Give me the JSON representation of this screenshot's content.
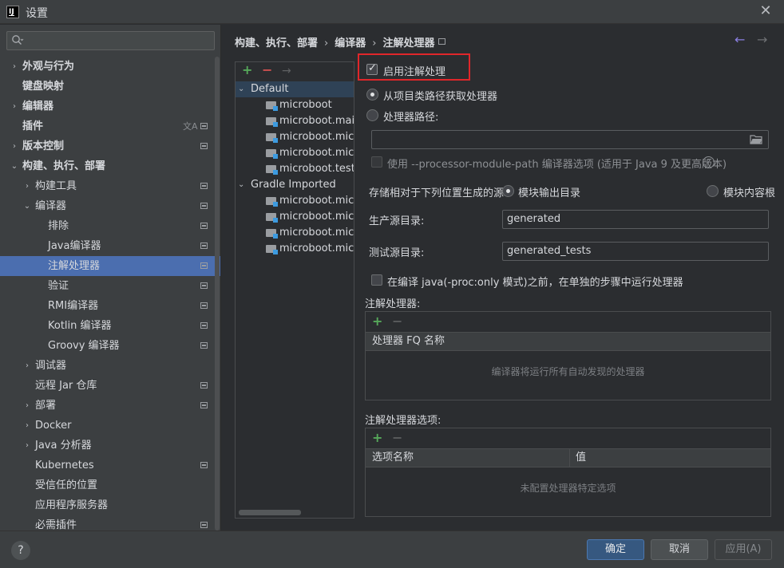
{
  "window": {
    "title": "设置",
    "logo_text": "IJ"
  },
  "search": {
    "placeholder": ""
  },
  "sidebar": {
    "items": [
      {
        "label": "外观与行为",
        "arrow": "›",
        "bold": true
      },
      {
        "label": "键盘映射",
        "arrow": "",
        "bold": true
      },
      {
        "label": "编辑器",
        "arrow": "›",
        "bold": true
      },
      {
        "label": "插件",
        "arrow": "",
        "bold": true
      },
      {
        "label": "版本控制",
        "arrow": "›",
        "bold": true
      },
      {
        "label": "构建、执行、部署",
        "arrow": "⌄",
        "bold": true
      },
      {
        "label": "构建工具",
        "arrow": "›"
      },
      {
        "label": "编译器",
        "arrow": "⌄"
      },
      {
        "label": "排除",
        "arrow": ""
      },
      {
        "label": "Java编译器",
        "arrow": ""
      },
      {
        "label": "注解处理器",
        "arrow": "",
        "selected": true
      },
      {
        "label": "验证",
        "arrow": ""
      },
      {
        "label": "RMI编译器",
        "arrow": ""
      },
      {
        "label": "Kotlin 编译器",
        "arrow": ""
      },
      {
        "label": "Groovy 编译器",
        "arrow": ""
      },
      {
        "label": "调试器",
        "arrow": "›"
      },
      {
        "label": "远程 Jar 仓库",
        "arrow": ""
      },
      {
        "label": "部署",
        "arrow": "›"
      },
      {
        "label": "Docker",
        "arrow": "›"
      },
      {
        "label": "Java 分析器",
        "arrow": "›"
      },
      {
        "label": "Kubernetes",
        "arrow": ""
      },
      {
        "label": "受信任的位置",
        "arrow": ""
      },
      {
        "label": "应用程序服务器",
        "arrow": ""
      },
      {
        "label": "必需插件",
        "arrow": ""
      }
    ]
  },
  "breadcrumb": {
    "parts": [
      "构建、执行、部署",
      "编译器",
      "注解处理器"
    ],
    "sep": "›"
  },
  "nav": {
    "back": "←",
    "forward": "→"
  },
  "modules": {
    "toolbar": {
      "add": "+",
      "remove": "−",
      "move": "→"
    },
    "groups": [
      {
        "name": "Default",
        "arrow": "⌄",
        "children": [
          "microboot",
          "microboot.main",
          "microboot.micr",
          "microboot.micr",
          "microboot.test"
        ]
      },
      {
        "name": "Gradle Imported",
        "arrow": "⌄",
        "children": [
          "microboot.micr",
          "microboot.micr",
          "microboot.micr",
          "microboot.micr"
        ]
      }
    ]
  },
  "settings": {
    "enable_label": "启用注解处理",
    "from_classpath_label": "从项目类路径获取处理器",
    "processor_path_label": "处理器路径:",
    "processor_path_value": "",
    "module_path_label": "使用 --processor-module-path 编译器选项 (适用于 Java 9 及更高版本)",
    "help_glyph": "?",
    "store_label": "存储相对于下列位置生成的源:",
    "store_module_output": "模块输出目录",
    "store_module_content": "模块内容根",
    "prod_dir_label": "生产源目录:",
    "prod_dir_value": "generated",
    "test_dir_label": "测试源目录:",
    "test_dir_value": "generated_tests",
    "proc_only_label": "在编译 java(-proc:only 模式)之前，在单独的步骤中运行处理器",
    "processors_section": "注解处理器:",
    "processors_col": "处理器 FQ 名称",
    "processors_empty": "编译器将运行所有自动发现的处理器",
    "options_section": "注解处理器选项:",
    "options_col_name": "选项名称",
    "options_col_value": "值",
    "options_empty": "未配置处理器特定选项",
    "add_glyph": "+",
    "remove_glyph": "−"
  },
  "footer": {
    "help": "?",
    "ok": "确定",
    "cancel": "取消",
    "apply": "应用(A)"
  },
  "colors": {
    "accent": "#4b6eaf",
    "highlight_box": "#e0262a",
    "ok_button": "#365880"
  }
}
